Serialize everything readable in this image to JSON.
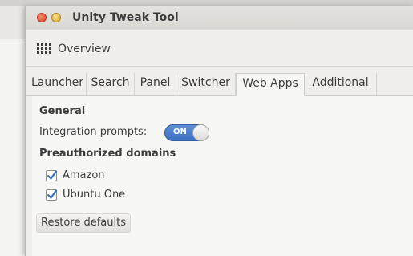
{
  "window": {
    "title": "Unity Tweak Tool"
  },
  "toolbar": {
    "overview_label": "Overview"
  },
  "tabs": [
    {
      "label": "Launcher",
      "active": false
    },
    {
      "label": "Search",
      "active": false
    },
    {
      "label": "Panel",
      "active": false
    },
    {
      "label": "Switcher",
      "active": false
    },
    {
      "label": "Web Apps",
      "active": true
    },
    {
      "label": "Additional",
      "active": false
    }
  ],
  "general": {
    "heading": "General",
    "integration_label": "Integration prompts:",
    "integration_switch": "ON"
  },
  "domains": {
    "heading": "Preauthorized domains",
    "items": [
      {
        "label": "Amazon",
        "checked": true
      },
      {
        "label": "Ubuntu One",
        "checked": true
      }
    ]
  },
  "restore_label": "Restore defaults",
  "colors": {
    "switch_on": "#4a7fcf",
    "check_mark": "#3a6fb8"
  }
}
